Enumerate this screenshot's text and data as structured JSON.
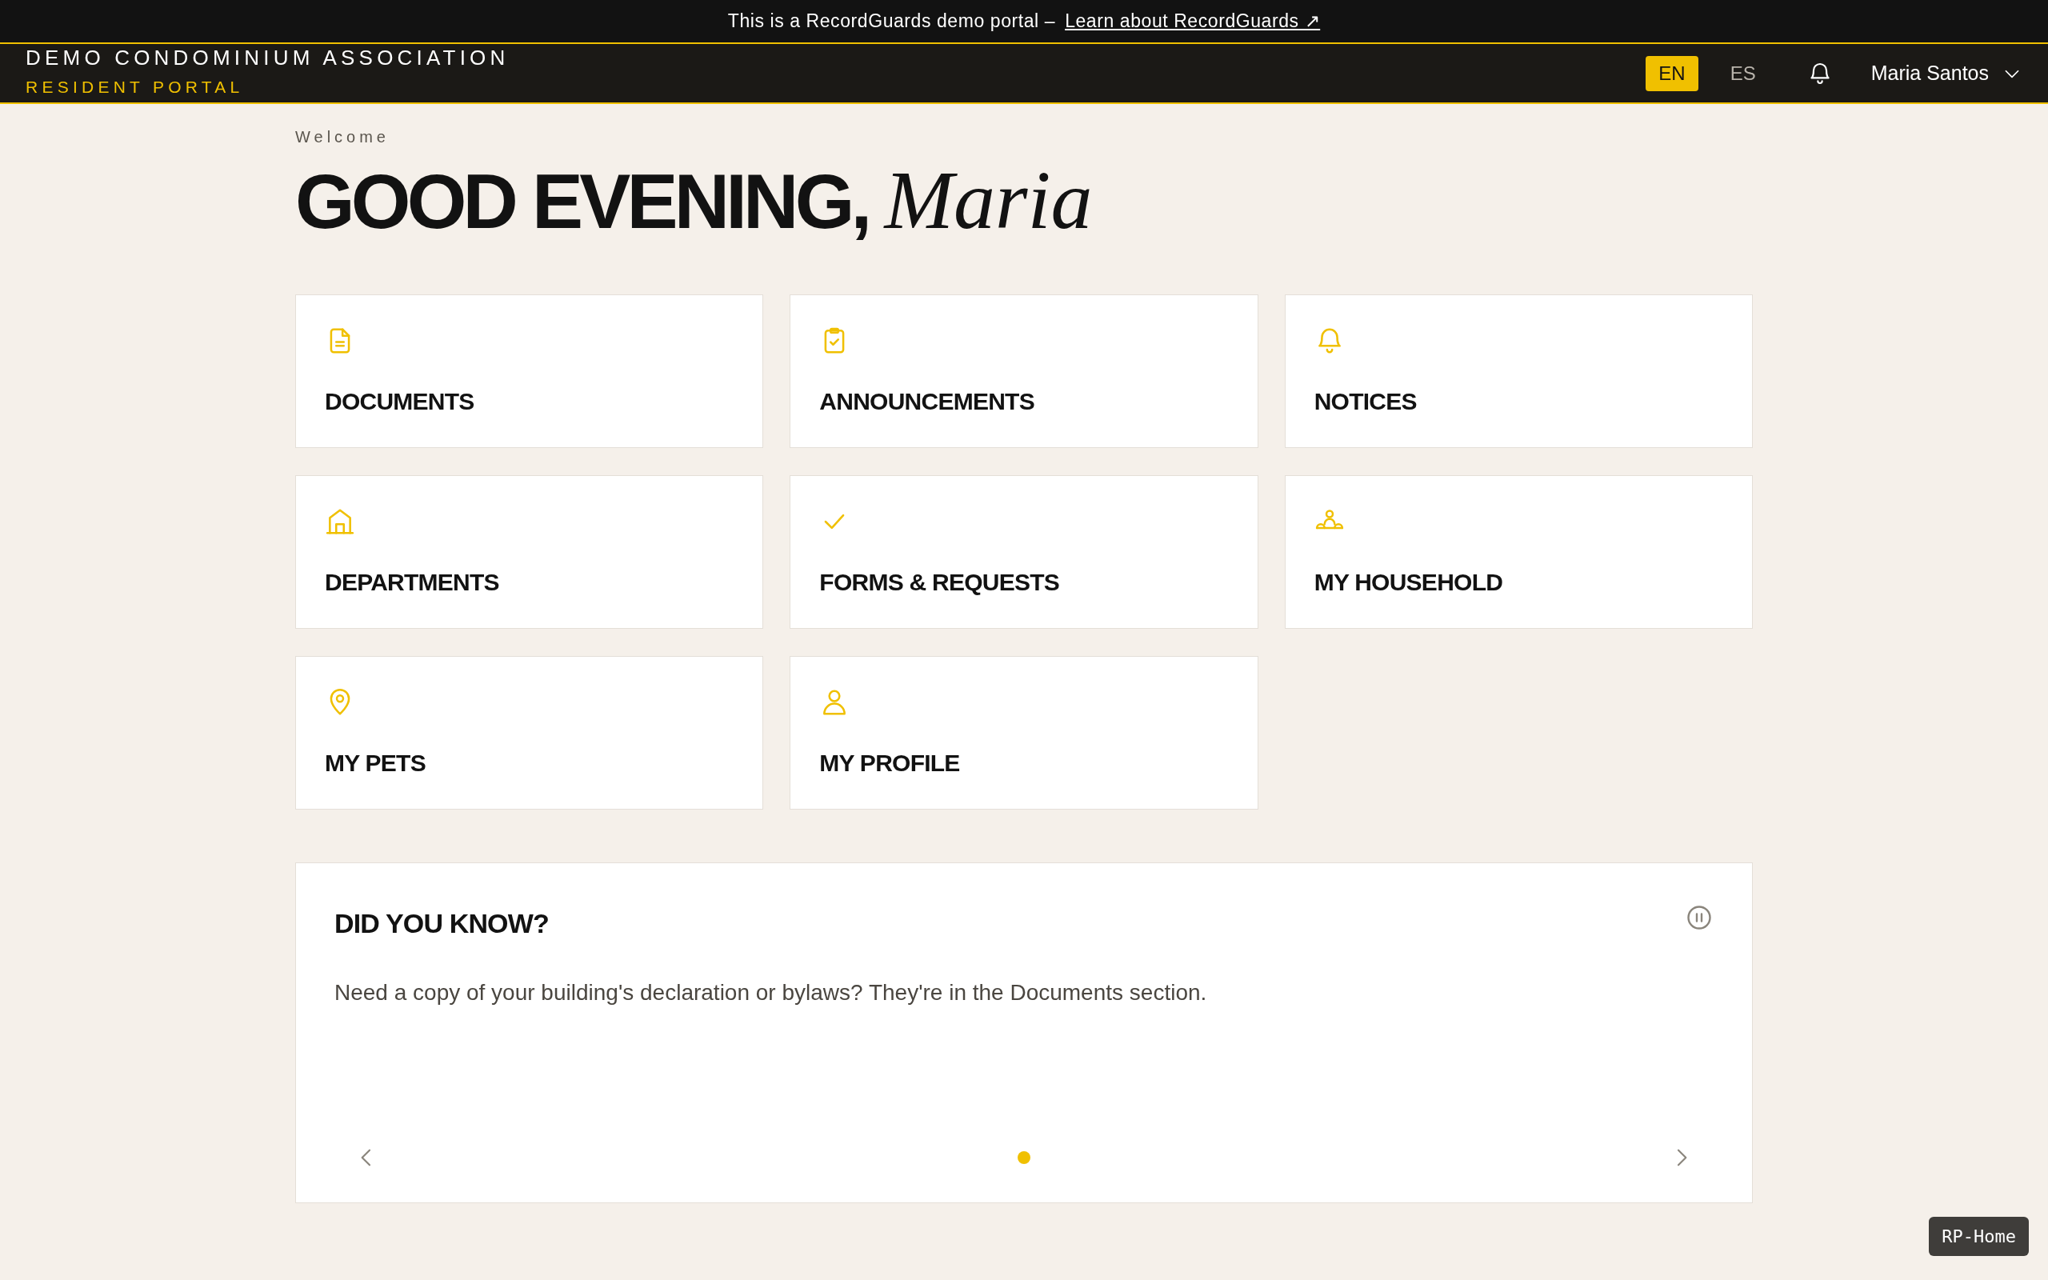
{
  "banner": {
    "text": "This is a RecordGuards demo portal –",
    "link": "Learn about RecordGuards ↗"
  },
  "header": {
    "title": "DEMO CONDOMINIUM ASSOCIATION",
    "subtitle": "RESIDENT PORTAL",
    "languages": [
      {
        "label": "EN",
        "selected": true
      },
      {
        "label": "ES",
        "selected": false
      }
    ],
    "user": "Maria Santos"
  },
  "welcome": {
    "eyebrow": "Welcome",
    "greeting": "GOOD EVENING,",
    "name": "Maria"
  },
  "tiles": [
    {
      "kind": "document",
      "label": "DOCUMENTS"
    },
    {
      "kind": "clipboard",
      "label": "ANNOUNCEMENTS"
    },
    {
      "kind": "bell",
      "label": "NOTICES"
    },
    {
      "kind": "building",
      "label": "DEPARTMENTS"
    },
    {
      "kind": "check",
      "label": "FORMS & REQUESTS"
    },
    {
      "kind": "people",
      "label": "MY HOUSEHOLD"
    },
    {
      "kind": "pin",
      "label": "MY PETS"
    },
    {
      "kind": "person",
      "label": "MY PROFILE"
    }
  ],
  "tips": {
    "title": "DID YOU KNOW?",
    "text": "Need a copy of your building's declaration or bylaws? They're in the Documents section.",
    "slides": [
      {
        "selected": true
      }
    ]
  },
  "page_tag": "RP-Home"
}
